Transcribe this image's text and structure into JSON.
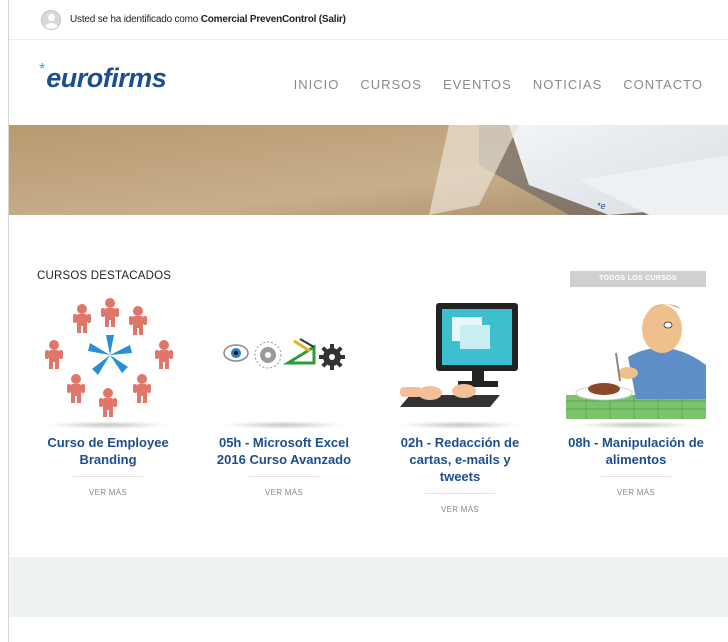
{
  "topbar": {
    "prefix": "Usted se ha identificado como ",
    "user": "Comercial PrevenControl",
    "logout": "(Salir)"
  },
  "logo": {
    "text": "eurofirms",
    "star_icon": "asterisk-star-icon"
  },
  "nav": {
    "items": [
      {
        "label": "INICIO"
      },
      {
        "label": "CURSOS"
      },
      {
        "label": "EVENTOS"
      },
      {
        "label": "NOTICIAS"
      },
      {
        "label": "CONTACTO"
      }
    ]
  },
  "featured": {
    "title": "CURSOS DESTACADOS",
    "all_button": "TODOS LOS CURSOS",
    "courses": [
      {
        "title": "Curso de Employee Branding",
        "more": "VER MÁS",
        "icon": "people-network-icon"
      },
      {
        "title": "05h - Microsoft Excel 2016 Curso Avanzado",
        "more": "VER MÁS",
        "icon": "eye-gears-icon"
      },
      {
        "title": "02h - Redacción de cartas, e-mails y tweets",
        "more": "VER MÁS",
        "icon": "computer-typing-icon"
      },
      {
        "title": "08h - Manipulación de alimentos",
        "more": "VER MÁS",
        "icon": "man-eating-icon"
      }
    ]
  },
  "colors": {
    "brand_blue": "#1d4e8f",
    "accent_cyan": "#29a8e0",
    "nav_gray": "#8a8a8a",
    "button_gray": "#d0d0d0",
    "footer_band": "#eff2f2"
  }
}
